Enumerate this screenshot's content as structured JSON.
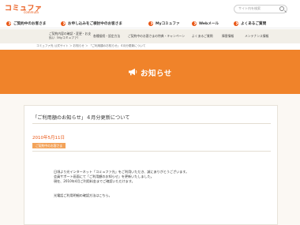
{
  "brand": {
    "logo_text": "コミュファ",
    "logo_sub": "commufa"
  },
  "search": {
    "placeholder": "サイト内を検索"
  },
  "main_nav": {
    "items": [
      {
        "label": "ご契約中のお客さま"
      },
      {
        "label": "お申し込みをご検討中のお客さま"
      },
      {
        "label": "Myコミュファ"
      },
      {
        "label": "Webメール"
      },
      {
        "label": "よくあるご質問"
      }
    ]
  },
  "sub_nav": {
    "items": [
      {
        "label": "ご契約内容の確認・変更・お支"
      },
      {
        "label": "払い（Myコミュファ）"
      },
      {
        "label": "各種接続・設定方法"
      },
      {
        "label": "ご契約中のお客さまの特典・キャンペーン"
      },
      {
        "label": "よくあるご質問"
      },
      {
        "label": "障害情報"
      },
      {
        "label": "メンテナンス情報"
      }
    ]
  },
  "breadcrumb": {
    "text": "コミュファ光 公式サイト ＞ お知らせ ＞ 「ご利用額のお知らせ」４月分更新について"
  },
  "hero": {
    "title": "お知らせ",
    "icon": "megaphone-icon"
  },
  "article": {
    "title": "「ご利用額のお知らせ」４月分更新について",
    "date": "2010年5月11日",
    "category_badge": "ご契約中のお客さま",
    "paragraphs": [
      "日頃より光インターネット「コミュファ光」をご利用いただき、誠にありがとうございます。",
      "会員サポート画面にて「ご利用額のお知らせ」を更新いたしました。",
      "現在、2010年4月ご利用料金までご確認いただけます。",
      "",
      "光電話ご利用明細の確認方法はこちら。"
    ]
  },
  "colors": {
    "accent": "#e95513",
    "hero": "#f0832a",
    "subnav_bg": "#f2efe8",
    "content_bg": "#fbf8f3"
  }
}
